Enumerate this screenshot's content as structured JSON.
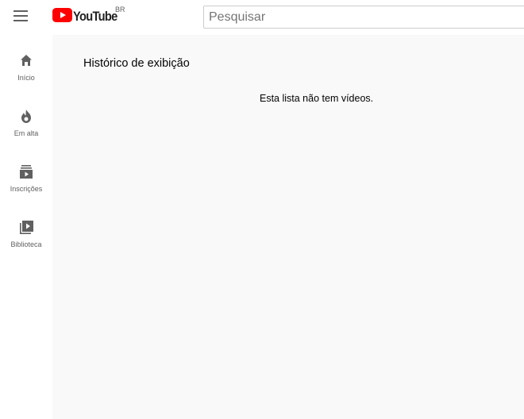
{
  "header": {
    "logo_text": "YouTube",
    "country_code": "BR",
    "search_placeholder": "Pesquisar"
  },
  "sidebar": {
    "items": [
      {
        "label": "Início",
        "icon": "home-icon"
      },
      {
        "label": "Em alta",
        "icon": "trending-icon"
      },
      {
        "label": "Inscrições",
        "icon": "subscriptions-icon"
      },
      {
        "label": "Biblioteca",
        "icon": "library-icon"
      }
    ]
  },
  "main": {
    "title": "Histórico de exibição",
    "empty_message": "Esta lista não tem vídeos."
  },
  "colors": {
    "brand_red": "#ff0000",
    "content_bg": "#f9f9f9",
    "icon_color": "#606060"
  }
}
